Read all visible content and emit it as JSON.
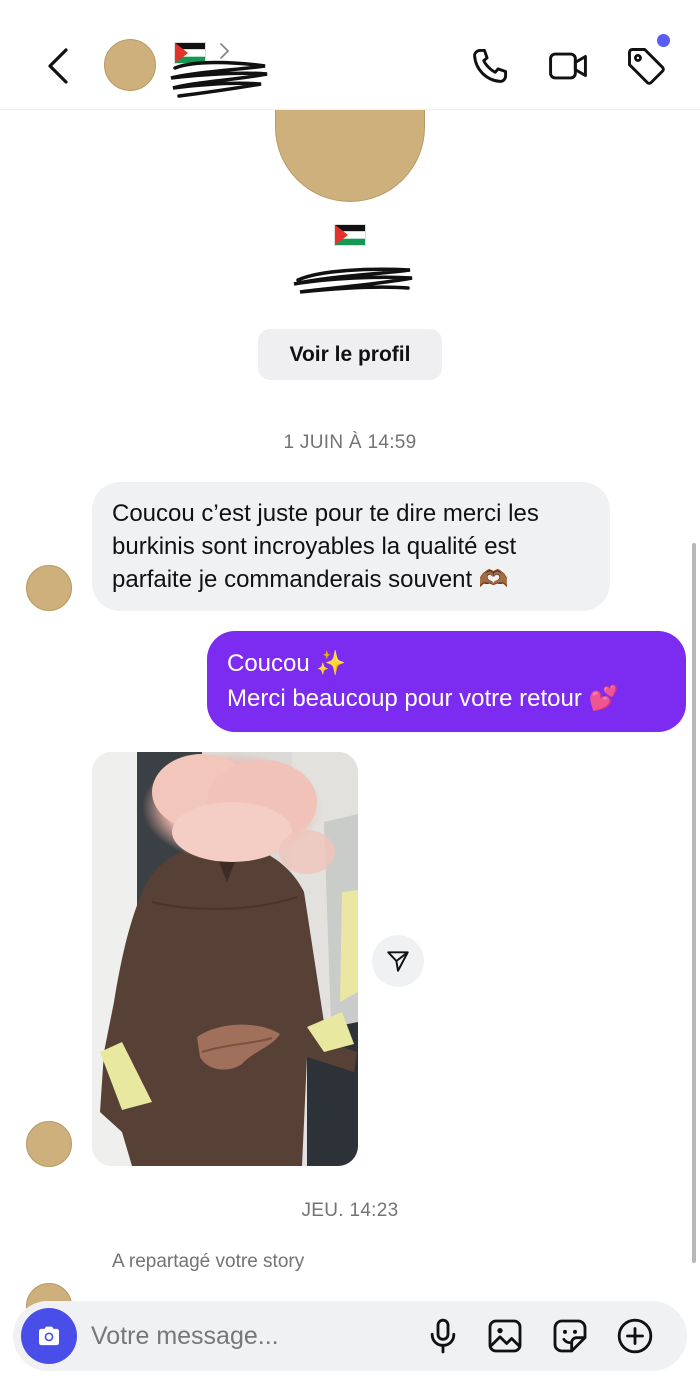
{
  "header": {
    "flag_emoji": "🇵🇸",
    "has_notification": true
  },
  "profile": {
    "flag_emoji": "🇵🇸",
    "view_profile_label": "Voir le profil"
  },
  "messages": {
    "timestamp_1": "1 JUIN À 14:59",
    "incoming_text": {
      "line1": "Coucou c’est juste pour te dire merci les",
      "line2": "burkinis sont incroyables la qualité est",
      "line3": "parfaite je commanderais souvent 🫶🏾"
    },
    "outgoing_text": {
      "line1": "Coucou ✨",
      "line2": "Merci beaucoup pour votre retour 💕"
    },
    "timestamp_2": "JEU. 14:23",
    "story_note": "A repartagé votre story"
  },
  "composer": {
    "placeholder": "Votre message..."
  },
  "colors": {
    "accent": "#7c2bf0",
    "camera_button": "#4a4ee8",
    "incoming_bubble": "#f0f1f3",
    "avatar": "#cdb07c"
  },
  "icons": [
    "back-icon",
    "phone-icon",
    "video-camera-icon",
    "tag-icon",
    "send-icon",
    "camera-icon",
    "microphone-icon",
    "gallery-icon",
    "sticker-icon",
    "plus-icon"
  ]
}
